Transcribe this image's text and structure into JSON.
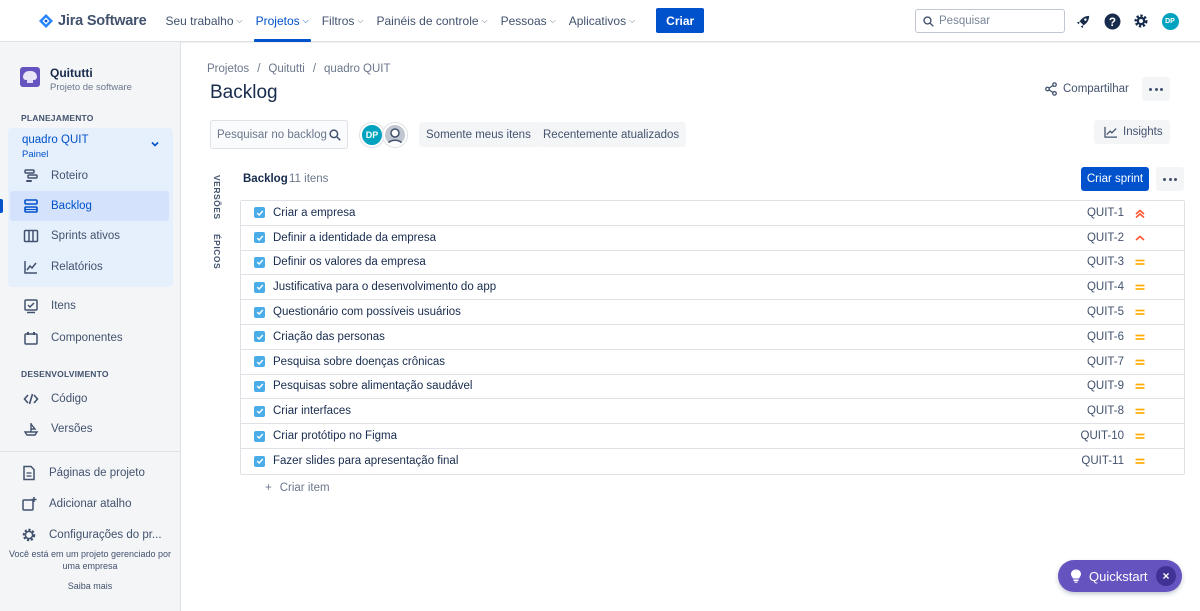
{
  "app": {
    "name": "Jira Software",
    "nav": [
      {
        "label": "Seu trabalho",
        "active": false
      },
      {
        "label": "Projetos",
        "active": true
      },
      {
        "label": "Filtros",
        "active": false
      },
      {
        "label": "Painéis de controle",
        "active": false
      },
      {
        "label": "Pessoas",
        "active": false
      },
      {
        "label": "Aplicativos",
        "active": false
      }
    ],
    "create_label": "Criar",
    "search_placeholder": "Pesquisar",
    "user_initials": "DP"
  },
  "sidebar": {
    "project_name": "Quitutti",
    "project_type": "Projeto de software",
    "planning_label": "PLANEJAMENTO",
    "board_name": "quadro QUIT",
    "board_sub": "Painel",
    "planning_items": [
      {
        "label": "Roteiro",
        "icon": "roadmap-icon"
      },
      {
        "label": "Backlog",
        "icon": "backlog-icon",
        "selected": true
      },
      {
        "label": "Sprints ativos",
        "icon": "board-icon"
      },
      {
        "label": "Relatórios",
        "icon": "reports-icon"
      }
    ],
    "other_items": [
      {
        "label": "Itens",
        "icon": "issues-icon"
      },
      {
        "label": "Componentes",
        "icon": "components-icon"
      }
    ],
    "dev_label": "DESENVOLVIMENTO",
    "dev_items": [
      {
        "label": "Código",
        "icon": "code-icon"
      },
      {
        "label": "Versões",
        "icon": "releases-icon"
      }
    ],
    "bottom_items": [
      {
        "label": "Páginas de projeto",
        "icon": "pages-icon"
      },
      {
        "label": "Adicionar atalho",
        "icon": "add-shortcut-icon"
      },
      {
        "label": "Configurações do pr...",
        "icon": "settings-icon"
      }
    ],
    "footer_text": "Você está em um projeto gerenciado por uma empresa",
    "footer_link": "Saiba mais"
  },
  "main": {
    "breadcrumb": [
      "Projetos",
      "Quitutti",
      "quadro QUIT"
    ],
    "title": "Backlog",
    "share_label": "Compartilhar",
    "search_placeholder": "Pesquisar no backlog",
    "avatar_initials": "DP",
    "filters": [
      "Somente meus itens",
      "Recentemente atualizados"
    ],
    "insights_label": "Insights",
    "side_tabs": [
      "VERSÕES",
      "ÉPICOS"
    ],
    "backlog_title": "Backlog",
    "backlog_count": "11 itens",
    "create_sprint_label": "Criar sprint",
    "create_item_label": "Criar item",
    "issues": [
      {
        "title": "Criar a empresa",
        "key": "QUIT-1",
        "priority": "highest"
      },
      {
        "title": "Definir a identidade da empresa",
        "key": "QUIT-2",
        "priority": "high"
      },
      {
        "title": "Definir os valores da empresa",
        "key": "QUIT-3",
        "priority": "medium"
      },
      {
        "title": "Justificativa para o desenvolvimento do app",
        "key": "QUIT-4",
        "priority": "medium"
      },
      {
        "title": "Questionário com possíveis usuários",
        "key": "QUIT-5",
        "priority": "medium"
      },
      {
        "title": "Criação das personas",
        "key": "QUIT-6",
        "priority": "medium"
      },
      {
        "title": "Pesquisa sobre doenças crônicas",
        "key": "QUIT-7",
        "priority": "medium"
      },
      {
        "title": "Pesquisas sobre alimentação saudável",
        "key": "QUIT-9",
        "priority": "medium"
      },
      {
        "title": "Criar interfaces",
        "key": "QUIT-8",
        "priority": "medium"
      },
      {
        "title": "Criar protótipo no Figma",
        "key": "QUIT-10",
        "priority": "medium"
      },
      {
        "title": "Fazer slides para apresentação final",
        "key": "QUIT-11",
        "priority": "medium"
      }
    ]
  },
  "quickstart": {
    "label": "Quickstart"
  },
  "colors": {
    "brand_blue": "#0052cc",
    "story_blue": "#4bade8",
    "priority_high": "#ff5630",
    "priority_medium": "#ffab00",
    "quickstart_purple": "#6554c0"
  }
}
